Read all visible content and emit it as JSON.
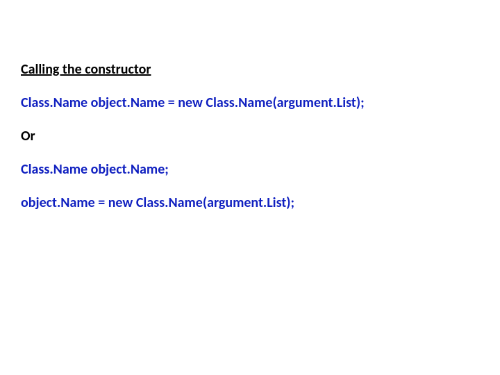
{
  "heading": "Calling the constructor",
  "line1": "Class.Name  object.Name = new  Class.Name(argument.List);",
  "or": "Or",
  "line2": "Class.Name  object.Name;",
  "line3": "object.Name = new  Class.Name(argument.List);"
}
